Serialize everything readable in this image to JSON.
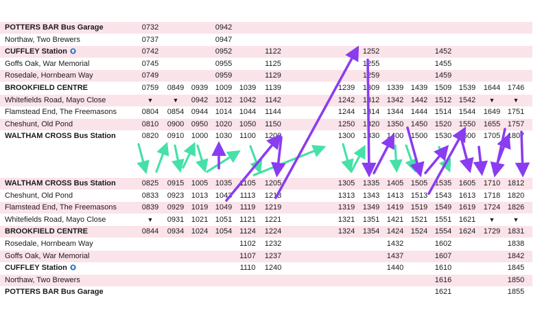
{
  "timetable": {
    "upper_rows": [
      {
        "stop": "POTTERS BAR Bus Garage",
        "bold": true,
        "pink": true,
        "icon": false,
        "times": [
          [
            "0732",
            0
          ],
          [
            "0942",
            3
          ]
        ]
      },
      {
        "stop": "Northaw, Two Brewers",
        "bold": false,
        "pink": false,
        "icon": false,
        "times": [
          [
            "0737",
            0
          ],
          [
            "0947",
            3
          ]
        ]
      },
      {
        "stop": "CUFFLEY Station",
        "bold": true,
        "pink": true,
        "icon": true,
        "times": [
          [
            "0742",
            0
          ],
          [
            "0952",
            3
          ],
          [
            "1122",
            5
          ],
          [
            "1252",
            7
          ],
          [
            "1452",
            10
          ]
        ]
      },
      {
        "stop": "Goffs Oak, War Memorial",
        "bold": false,
        "pink": false,
        "icon": false,
        "times": [
          [
            "0745",
            0
          ],
          [
            "0955",
            3
          ],
          [
            "1125",
            5
          ],
          [
            "1255",
            7
          ],
          [
            "1455",
            10
          ]
        ]
      },
      {
        "stop": "Rosedale, Hornbeam Way",
        "bold": false,
        "pink": true,
        "icon": false,
        "times": [
          [
            "0749",
            0
          ],
          [
            "0959",
            3
          ],
          [
            "1129",
            5
          ],
          [
            "1259",
            7
          ],
          [
            "1459",
            10
          ]
        ]
      },
      {
        "stop": "BROOKFIELD CENTRE",
        "bold": true,
        "pink": false,
        "icon": false,
        "times": [
          [
            "0759",
            0
          ],
          [
            "0849",
            1
          ],
          [
            "0939",
            2
          ],
          [
            "1009",
            3
          ],
          [
            "1039",
            4
          ],
          [
            "1139",
            5
          ],
          [
            "1239",
            6
          ],
          [
            "1309",
            7
          ],
          [
            "1339",
            8
          ],
          [
            "1439",
            9
          ],
          [
            "1509",
            10
          ],
          [
            "1539",
            11
          ],
          [
            "1644",
            12
          ],
          [
            "1746",
            13
          ]
        ]
      },
      {
        "stop": "Whitefields Road, Mayo Close",
        "bold": false,
        "pink": true,
        "icon": false,
        "times": [
          [
            "▼",
            0
          ],
          [
            "▼",
            1
          ],
          [
            "0942",
            2
          ],
          [
            "1012",
            3
          ],
          [
            "1042",
            4
          ],
          [
            "1142",
            5
          ],
          [
            "1242",
            6
          ],
          [
            "1312",
            7
          ],
          [
            "1342",
            8
          ],
          [
            "1442",
            9
          ],
          [
            "1512",
            10
          ],
          [
            "1542",
            11
          ],
          [
            "▼",
            12
          ],
          [
            "▼",
            13
          ]
        ]
      },
      {
        "stop": "Flamstead End, The Freemasons",
        "bold": false,
        "pink": false,
        "icon": false,
        "times": [
          [
            "0804",
            0
          ],
          [
            "0854",
            1
          ],
          [
            "0944",
            2
          ],
          [
            "1014",
            3
          ],
          [
            "1044",
            4
          ],
          [
            "1144",
            5
          ],
          [
            "1244",
            6
          ],
          [
            "1314",
            7
          ],
          [
            "1344",
            8
          ],
          [
            "1444",
            9
          ],
          [
            "1514",
            10
          ],
          [
            "1544",
            11
          ],
          [
            "1649",
            12
          ],
          [
            "1751",
            13
          ]
        ]
      },
      {
        "stop": "Cheshunt, Old Pond",
        "bold": false,
        "pink": true,
        "icon": false,
        "times": [
          [
            "0810",
            0
          ],
          [
            "0900",
            1
          ],
          [
            "0950",
            2
          ],
          [
            "1020",
            3
          ],
          [
            "1050",
            4
          ],
          [
            "1150",
            5
          ],
          [
            "1250",
            6
          ],
          [
            "1320",
            7
          ],
          [
            "1350",
            8
          ],
          [
            "1450",
            9
          ],
          [
            "1520",
            10
          ],
          [
            "1550",
            11
          ],
          [
            "1655",
            12
          ],
          [
            "1757",
            13
          ]
        ]
      },
      {
        "stop": "WALTHAM CROSS Bus Station",
        "bold": true,
        "pink": false,
        "icon": false,
        "times": [
          [
            "0820",
            0
          ],
          [
            "0910",
            1
          ],
          [
            "1000",
            2
          ],
          [
            "1030",
            3
          ],
          [
            "1100",
            4
          ],
          [
            "1200",
            5
          ],
          [
            "1300",
            6
          ],
          [
            "1330",
            7
          ],
          [
            "1400",
            8
          ],
          [
            "1500",
            9
          ],
          [
            "1530",
            10
          ],
          [
            "1600",
            11
          ],
          [
            "1705",
            12
          ],
          [
            "1807",
            13
          ]
        ]
      }
    ],
    "lower_rows": [
      {
        "stop": "WALTHAM CROSS Bus Station",
        "bold": true,
        "pink": true,
        "icon": false,
        "times": [
          [
            "0825",
            0
          ],
          [
            "0915",
            1
          ],
          [
            "1005",
            2
          ],
          [
            "1035",
            3
          ],
          [
            "1105",
            4
          ],
          [
            "1205",
            5
          ],
          [
            "1305",
            6
          ],
          [
            "1335",
            7
          ],
          [
            "1405",
            8
          ],
          [
            "1505",
            9
          ],
          [
            "1535",
            10
          ],
          [
            "1605",
            11
          ],
          [
            "1710",
            12
          ],
          [
            "1812",
            13
          ]
        ]
      },
      {
        "stop": "Cheshunt, Old Pond",
        "bold": false,
        "pink": false,
        "icon": false,
        "times": [
          [
            "0833",
            0
          ],
          [
            "0923",
            1
          ],
          [
            "1013",
            2
          ],
          [
            "1043",
            3
          ],
          [
            "1113",
            4
          ],
          [
            "1213",
            5
          ],
          [
            "1313",
            6
          ],
          [
            "1343",
            7
          ],
          [
            "1413",
            8
          ],
          [
            "1513",
            9
          ],
          [
            "1543",
            10
          ],
          [
            "1613",
            11
          ],
          [
            "1718",
            12
          ],
          [
            "1820",
            13
          ]
        ]
      },
      {
        "stop": "Flamstead End, The Freemasons",
        "bold": false,
        "pink": true,
        "icon": false,
        "times": [
          [
            "0839",
            0
          ],
          [
            "0929",
            1
          ],
          [
            "1019",
            2
          ],
          [
            "1049",
            3
          ],
          [
            "1119",
            4
          ],
          [
            "1219",
            5
          ],
          [
            "1319",
            6
          ],
          [
            "1349",
            7
          ],
          [
            "1419",
            8
          ],
          [
            "1519",
            9
          ],
          [
            "1549",
            10
          ],
          [
            "1619",
            11
          ],
          [
            "1724",
            12
          ],
          [
            "1826",
            13
          ]
        ]
      },
      {
        "stop": "Whitefields Road, Mayo Close",
        "bold": false,
        "pink": false,
        "icon": false,
        "times": [
          [
            "▼",
            0
          ],
          [
            "0931",
            1
          ],
          [
            "1021",
            2
          ],
          [
            "1051",
            3
          ],
          [
            "1121",
            4
          ],
          [
            "1221",
            5
          ],
          [
            "1321",
            6
          ],
          [
            "1351",
            7
          ],
          [
            "1421",
            8
          ],
          [
            "1521",
            9
          ],
          [
            "1551",
            10
          ],
          [
            "1621",
            11
          ],
          [
            "▼",
            12
          ],
          [
            "▼",
            13
          ]
        ]
      },
      {
        "stop": "BROOKFIELD CENTRE",
        "bold": true,
        "pink": true,
        "icon": false,
        "times": [
          [
            "0844",
            0
          ],
          [
            "0934",
            1
          ],
          [
            "1024",
            2
          ],
          [
            "1054",
            3
          ],
          [
            "1124",
            4
          ],
          [
            "1224",
            5
          ],
          [
            "1324",
            6
          ],
          [
            "1354",
            7
          ],
          [
            "1424",
            8
          ],
          [
            "1524",
            9
          ],
          [
            "1554",
            10
          ],
          [
            "1624",
            11
          ],
          [
            "1729",
            12
          ],
          [
            "1831",
            13
          ]
        ]
      },
      {
        "stop": "Rosedale, Hornbeam Way",
        "bold": false,
        "pink": false,
        "icon": false,
        "times": [
          [
            "1102",
            4
          ],
          [
            "1232",
            5
          ],
          [
            "1432",
            8
          ],
          [
            "1602",
            10
          ],
          [
            "1838",
            13
          ]
        ]
      },
      {
        "stop": "Goffs Oak, War Memorial",
        "bold": false,
        "pink": true,
        "icon": false,
        "times": [
          [
            "1107",
            4
          ],
          [
            "1237",
            5
          ],
          [
            "1437",
            8
          ],
          [
            "1607",
            10
          ],
          [
            "1842",
            13
          ]
        ]
      },
      {
        "stop": "CUFFLEY Station",
        "bold": true,
        "pink": false,
        "icon": true,
        "times": [
          [
            "1110",
            4
          ],
          [
            "1240",
            5
          ],
          [
            "1440",
            8
          ],
          [
            "1610",
            10
          ],
          [
            "1845",
            13
          ]
        ]
      },
      {
        "stop": "Northaw, Two Brewers",
        "bold": false,
        "pink": true,
        "icon": false,
        "times": [
          [
            "1616",
            10
          ],
          [
            "1850",
            13
          ]
        ]
      },
      {
        "stop": "POTTERS BAR Bus Garage",
        "bold": true,
        "pink": false,
        "icon": false,
        "times": [
          [
            "1621",
            10
          ],
          [
            "1855",
            13
          ]
        ]
      }
    ]
  },
  "colors": {
    "row_pink": "#fbe3ea",
    "green_arrow": "#46e0a8",
    "purple_arrow": "#8a3cf0",
    "station_icon": "#2d6fc9"
  },
  "icons": {
    "station": "train-station-icon"
  }
}
